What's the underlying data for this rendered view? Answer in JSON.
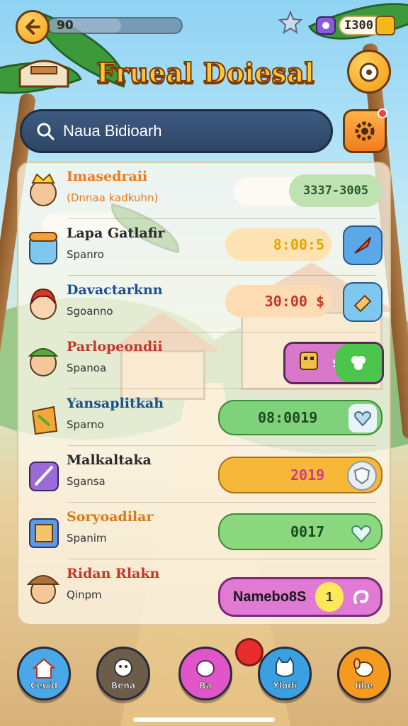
{
  "header": {
    "level": "90",
    "progress": 0.55,
    "currency": "I300",
    "title": "Frueal Doiesal"
  },
  "search": {
    "placeholder": "Naua Bidioarh"
  },
  "list": [
    {
      "title": "Imasedraii",
      "subtitle": "(Dnnaa kadkuhn)",
      "title_color": "#f07a1a",
      "subtitle_color": "#f07a1a",
      "value": "3337-3005",
      "pill_color": "#bfe3b0",
      "pill_text_color": "#2a5a2a",
      "avatar_icon": "crowned-character-icon"
    },
    {
      "title": "Lapa Gatlafir",
      "subtitle": "Spanro",
      "title_color": "#2a2a2a",
      "subtitle_color": "#333333",
      "value": "8:00:5",
      "pill_color": "#fde2b4",
      "pill_text_color": "#e9a500",
      "avatar_icon": "robot-character-icon",
      "action_icon": "quill-icon"
    },
    {
      "title": "Davactarknn",
      "subtitle": "Sgoanno",
      "title_color": "#1d4f8a",
      "subtitle_color": "#333333",
      "value": "30:00 $",
      "pill_color": "#fddcb4",
      "pill_text_color": "#c0392b",
      "avatar_icon": "redhead-character-icon",
      "action_icon": "eraser-icon"
    },
    {
      "title": "Parlopeondii",
      "subtitle": "Spanoa",
      "title_color": "#c0392b",
      "subtitle_color": "#333333",
      "value": "$",
      "pill_color": "#d978c9",
      "pill_text_color": "#ffffff",
      "avatar_icon": "capped-character-icon",
      "action_icon": "robot-toy-icon"
    },
    {
      "title": "Yansaplitkah",
      "subtitle": "Sparno",
      "title_color": "#1d4f8a",
      "subtitle_color": "#333333",
      "value": "08:0019",
      "pill_color": "#7ed37a",
      "pill_text_color": "#1f4a1f",
      "avatar_icon": "potion-icon",
      "action_icon": "heart-icon"
    },
    {
      "title": "Malkaltaka",
      "subtitle": "Sgansa",
      "title_color": "#2a2a2a",
      "subtitle_color": "#333333",
      "value": "2019",
      "pill_color": "#f7b83a",
      "pill_text_color": "#d23b8a",
      "avatar_icon": "sword-icon",
      "action_icon": "shield-icon"
    },
    {
      "title": "Soryoadilar",
      "subtitle": "Spanim",
      "title_color": "#d97a16",
      "subtitle_color": "#333333",
      "value": "0017",
      "pill_color": "#8bd87e",
      "pill_text_color": "#1f4a1f",
      "avatar_icon": "frame-icon",
      "action_icon": "check-heart-icon"
    },
    {
      "title": "Ridan Rlakn",
      "subtitle": "Qinpm",
      "title_color": "#c0392b",
      "subtitle_color": "#333333",
      "value": "Namebo8S",
      "badge": "1",
      "pill_color": "#e07ad2",
      "pill_text_color": "#1a1a1a",
      "avatar_icon": "hat-character-icon",
      "action_icon": "swirl-icon"
    }
  ],
  "nav": [
    {
      "label": "Ceuid",
      "color": "#4aa8e8",
      "icon": "home-icon"
    },
    {
      "label": "Bena",
      "color": "#6b5d4a",
      "icon": "ghost-cat-icon"
    },
    {
      "label": "Ba",
      "color": "#e055c8",
      "icon": "pet-icon"
    },
    {
      "label": "Ylodi",
      "color": "#3aa0e0",
      "icon": "cat-icon"
    },
    {
      "label": "Iibe",
      "color": "#f59a1c",
      "icon": "dog-icon"
    }
  ]
}
